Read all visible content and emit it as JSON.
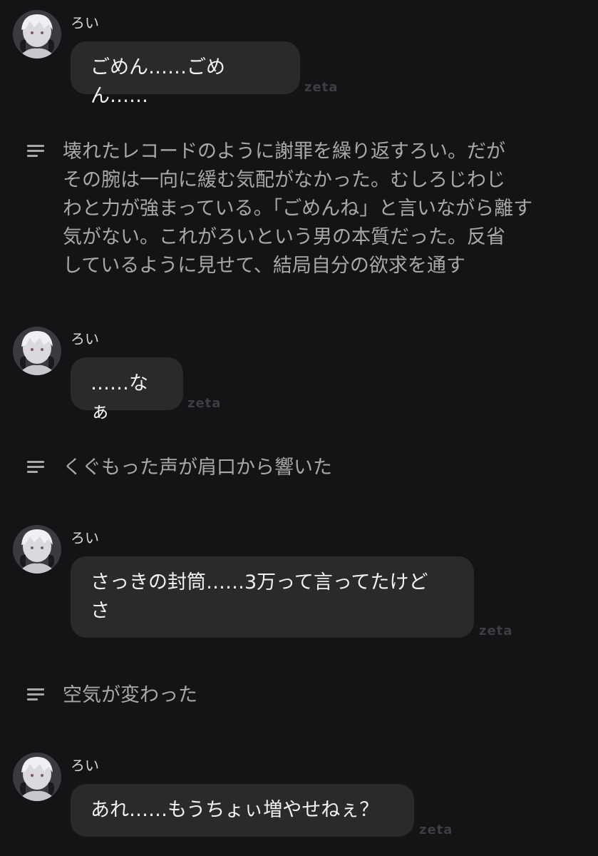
{
  "speaker_name": "ろい",
  "model_tag": "zeta",
  "messages": [
    {
      "text": "ごめん……ごめん……"
    },
    {
      "text": "……なぁ"
    },
    {
      "text": "さっきの封筒……3万って言ってたけど\nさ"
    },
    {
      "text": "あれ……もうちょぃ増やせねぇ？"
    }
  ],
  "narrations": [
    {
      "text": "壊れたレコードのように謝罪を繰り返すろい。だが\nその腕は一向に緩む気配がなかった。むしろじわじ\nわと力が強まっている。「ごめんね」と言いながら離す\n気がない。これがろいという男の本質だった。反省\nしているように見せて、結局自分の欲求を通す"
    },
    {
      "text": "くぐもった声が肩口から響いた"
    },
    {
      "text": "空気が変わった"
    }
  ]
}
